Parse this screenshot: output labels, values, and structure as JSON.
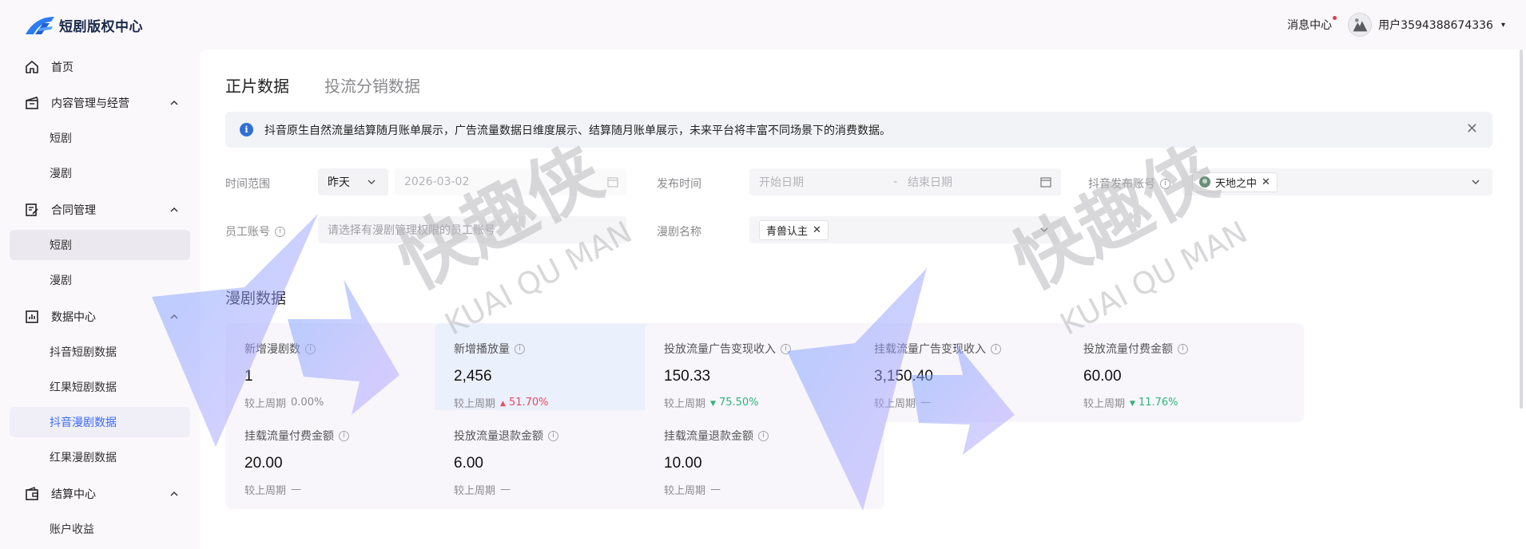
{
  "header": {
    "app_title": "短剧版权中心",
    "message_center": "消息中心",
    "username": "用户3594388674336",
    "caret": "▾"
  },
  "sidebar": {
    "groups": [
      {
        "label": "首页",
        "icon": "home-icon"
      },
      {
        "label": "内容管理与经营",
        "icon": "clapperboard-icon",
        "items": [
          "短剧",
          "漫剧"
        ]
      },
      {
        "label": "合同管理",
        "icon": "contract-icon",
        "items": [
          "短剧",
          "漫剧"
        ]
      },
      {
        "label": "数据中心",
        "icon": "bar-chart-icon",
        "items": [
          "抖音短剧数据",
          "红果短剧数据",
          "抖音漫剧数据",
          "红果漫剧数据"
        ]
      },
      {
        "label": "结算中心",
        "icon": "wallet-icon",
        "items": [
          "账户收益"
        ]
      }
    ],
    "selected_item": "合同管理 > 短剧",
    "active_item": "数据中心 > 抖音漫剧数据"
  },
  "tabs": [
    {
      "label": "正片数据",
      "active": true
    },
    {
      "label": "投流分销数据",
      "active": false
    }
  ],
  "notice": {
    "info_glyph": "i",
    "text": "抖音原生自然流量结算随月账单展示，广告流量数据日维度展示、结算随月账单展示，未来平台将丰富不同场景下的消费数据。",
    "close": "✕"
  },
  "filters": {
    "time_range_label": "时间范围",
    "time_range_value": "昨天",
    "date_value": "2026-03-02",
    "publish_time_label": "发布时间",
    "start_date_placeholder": "开始日期",
    "date_separator": "-",
    "end_date_placeholder": "结束日期",
    "douyin_account_label": "抖音发布账号",
    "douyin_account_tag": "天地之中",
    "employee_label": "员工账号",
    "employee_placeholder": "请选择有漫剧管理权限的员工账号",
    "drama_name_label": "漫剧名称",
    "drama_name_tag": "青兽认主",
    "tag_remove": "✕",
    "help_glyph": "i"
  },
  "section_title": "漫剧数据",
  "cards": [
    {
      "title": "新增漫剧数",
      "value": "1",
      "compare_label": "较上周期",
      "change": "0.00%",
      "trend": "flat",
      "highlight": false
    },
    {
      "title": "新增播放量",
      "value": "2,456",
      "compare_label": "较上周期",
      "change": "51.70%",
      "trend": "up",
      "highlight": true
    },
    {
      "title": "投放流量广告变现收入",
      "value": "150.33",
      "compare_label": "较上周期",
      "change": "75.50%",
      "trend": "down",
      "highlight": false
    },
    {
      "title": "挂载流量广告变现收入",
      "value": "3,150.40",
      "compare_label": "较上周期",
      "change": "—",
      "trend": "none",
      "highlight": false
    },
    {
      "title": "投放流量付费金额",
      "value": "60.00",
      "compare_label": "较上周期",
      "change": "11.76%",
      "trend": "down",
      "highlight": false
    },
    {
      "title": "挂载流量付费金额",
      "value": "20.00",
      "compare_label": "较上周期",
      "change": "—",
      "trend": "none",
      "highlight": false
    },
    {
      "title": "投放流量退款金额",
      "value": "6.00",
      "compare_label": "较上周期",
      "change": "—",
      "trend": "none",
      "highlight": false
    },
    {
      "title": "挂载流量退款金额",
      "value": "10.00",
      "compare_label": "较上周期",
      "change": "—",
      "trend": "none",
      "highlight": false
    }
  ],
  "trend_glyphs": {
    "up": "▲",
    "down": "▼"
  },
  "watermark": {
    "cn": "快趣侠",
    "en": "KUAI QU MAN"
  },
  "colors": {
    "primary": "#3b6cf6",
    "up": "#e84a5f",
    "down": "#2fb37a",
    "info": "#2f6fd6",
    "brand_logo": "#2b7cf0"
  }
}
